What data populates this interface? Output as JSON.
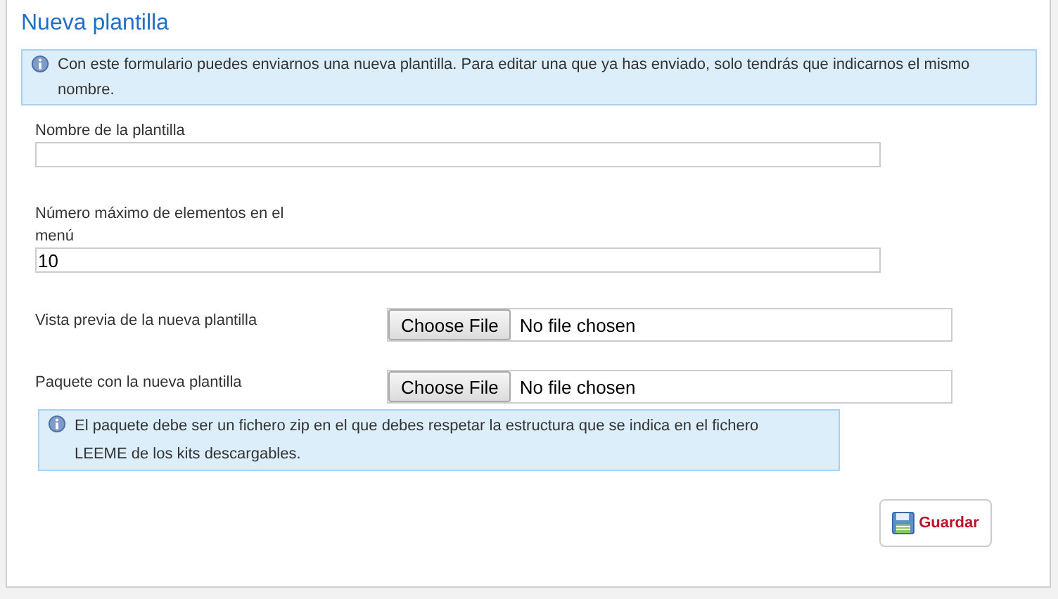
{
  "title": "Nueva plantilla",
  "info": "Con este formulario puedes enviarnos una nueva plantilla. Para editar una que ya has enviado, solo tendrás que indicarnos el mismo nombre.",
  "fields": [
    {
      "kind": "text",
      "label": "Nombre de la plantilla"
    },
    {
      "kind": "text",
      "label": "Número máximo de elementos en el menú",
      "value": "10"
    },
    {
      "kind": "file",
      "label": "Vista previa de la nueva plantilla",
      "button": "Choose File",
      "status": "No file chosen"
    },
    {
      "kind": "file",
      "label": "Paquete con la nueva plantilla",
      "button": "Choose File",
      "status": "No file chosen"
    }
  ],
  "package_note": "El paquete debe ser un fichero zip en el que debes respetar la estructura que se indica en el fichero LEEME de los kits descargables.",
  "save_button": "Guardar"
}
